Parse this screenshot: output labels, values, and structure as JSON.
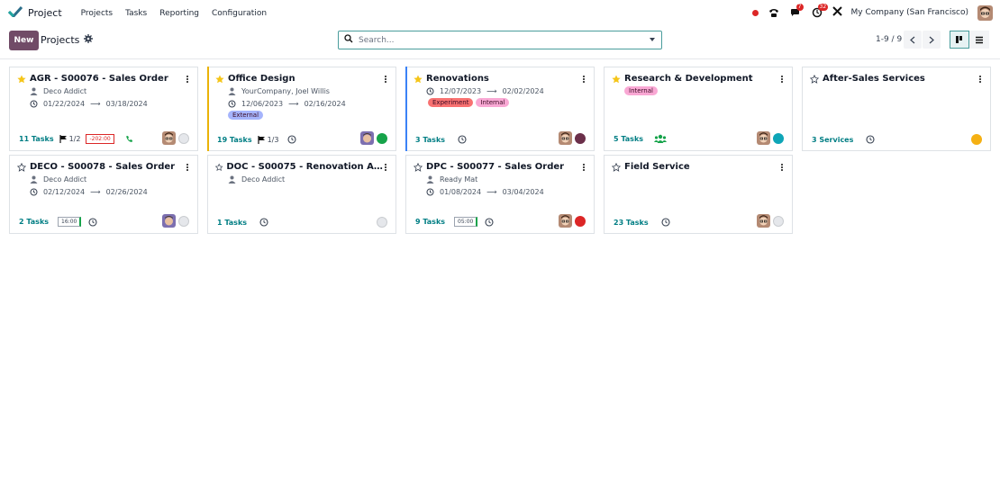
{
  "app": {
    "name": "Project",
    "logo_icon": "check-logo",
    "accent": "#714b67",
    "teal": "#017e84"
  },
  "menu": [
    "Projects",
    "Tasks",
    "Reporting",
    "Configuration"
  ],
  "systray": {
    "messages_count": "7",
    "activities_count": "32",
    "company": "My Company (San Francisco)"
  },
  "control_panel": {
    "new_label": "New",
    "title": "Projects",
    "search_placeholder": "Search...",
    "pager": "1-9 / 9",
    "active_view": "kanban"
  },
  "cards": [
    {
      "name": "AGR - S00076 - Sales Order",
      "favorite": true,
      "partner": "Deco Addict",
      "date_start": "01/22/2024",
      "date_end": "03/18/2024",
      "tags": [],
      "tasks": "11 Tasks",
      "milestone": "1/2",
      "deadline": "-202:00",
      "phone": true,
      "status": "none",
      "status_color": "",
      "accent_color": ""
    },
    {
      "name": "Office Design",
      "favorite": true,
      "partner": "YourCompany, Joel Willis",
      "date_start": "12/06/2023",
      "date_end": "02/16/2024",
      "tags": [
        {
          "label": "External",
          "color": "#a5b4fc"
        }
      ],
      "tasks": "19 Tasks",
      "milestone": "1/3",
      "status": "on_track",
      "status_color": "#16a34a",
      "accent_color": "#eab308"
    },
    {
      "name": "Renovations",
      "favorite": true,
      "partner": "",
      "date_start": "12/07/2023",
      "date_end": "02/02/2024",
      "tags": [
        {
          "label": "Experiment",
          "color": "#f87171"
        },
        {
          "label": "Internal",
          "color": "#f9a8d4"
        }
      ],
      "tasks": "3 Tasks",
      "status": "off_track",
      "status_color": "#6b2f4a",
      "accent_color": "#3b82f6"
    },
    {
      "name": "Research & Development",
      "favorite": true,
      "partner": "",
      "tags": [
        {
          "label": "Internal",
          "color": "#f9a8d4"
        }
      ],
      "tasks": "5 Tasks",
      "status": "at_risk",
      "status_color": "#0ea5b7",
      "accent_color": ""
    },
    {
      "name": "After-Sales Services",
      "favorite": false,
      "partner": "",
      "tags": [],
      "tasks": "3 Services",
      "status": "on_hold",
      "status_color": "#f5b013",
      "accent_color": ""
    },
    {
      "name": "DECO - S00078 - Sales Order",
      "favorite": false,
      "partner": "Deco Addict",
      "date_start": "02/12/2024",
      "date_end": "02/26/2024",
      "tags": [],
      "tasks": "2 Tasks",
      "time": "16:00",
      "status": "none",
      "status_color": "",
      "accent_color": ""
    },
    {
      "name": "DOC - S00075 - Renovation Architect",
      "favorite": false,
      "partner": "Deco Addict",
      "tags": [],
      "tasks": "1 Tasks",
      "status": "none",
      "status_color": "",
      "accent_color": ""
    },
    {
      "name": "DPC - S00077 - Sales Order",
      "favorite": false,
      "partner": "Ready Mat",
      "date_start": "01/08/2024",
      "date_end": "03/04/2024",
      "tags": [],
      "tasks": "9 Tasks",
      "time": "05:00",
      "status": "off_track_red",
      "status_color": "#dc2626",
      "accent_color": ""
    },
    {
      "name": "Field Service",
      "favorite": false,
      "partner": "",
      "tags": [],
      "tasks": "23 Tasks",
      "status": "none",
      "status_color": "",
      "accent_color": ""
    }
  ]
}
